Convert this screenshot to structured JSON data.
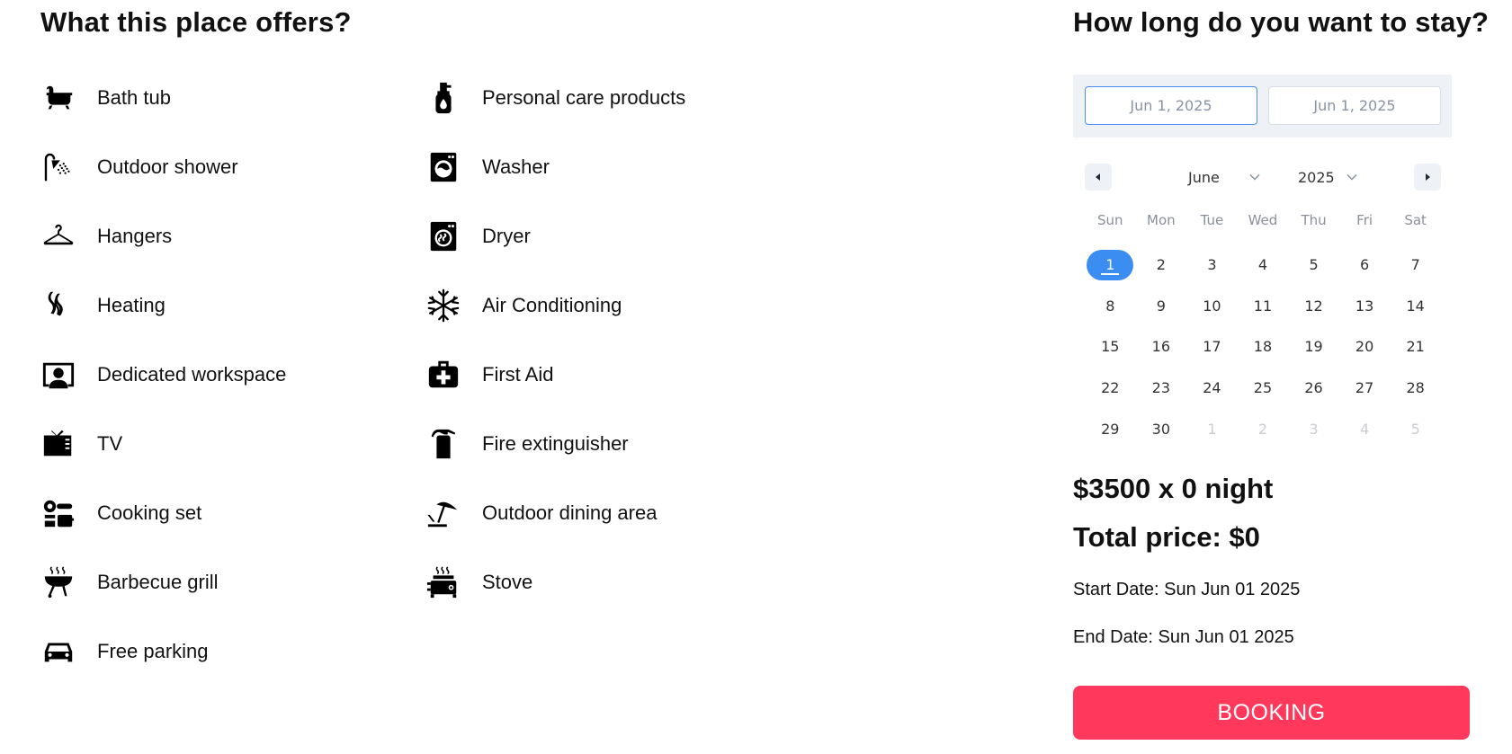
{
  "offers": {
    "title": "What this place offers?",
    "column1": [
      {
        "label": "Bath tub",
        "icon": "bathtub-icon"
      },
      {
        "label": "Outdoor shower",
        "icon": "shower-icon"
      },
      {
        "label": "Hangers",
        "icon": "hanger-icon"
      },
      {
        "label": "Heating",
        "icon": "heating-icon"
      },
      {
        "label": "Dedicated workspace",
        "icon": "workspace-icon"
      },
      {
        "label": "TV",
        "icon": "tv-icon"
      },
      {
        "label": "Cooking set",
        "icon": "cooking-set-icon"
      },
      {
        "label": "Barbecue grill",
        "icon": "barbecue-icon"
      },
      {
        "label": "Free parking",
        "icon": "car-icon"
      }
    ],
    "column2": [
      {
        "label": "Personal care products",
        "icon": "soap-bottle-icon"
      },
      {
        "label": "Washer",
        "icon": "washer-icon"
      },
      {
        "label": "Dryer",
        "icon": "dryer-icon"
      },
      {
        "label": "Air Conditioning",
        "icon": "snowflake-icon"
      },
      {
        "label": "First Aid",
        "icon": "first-aid-icon"
      },
      {
        "label": "Fire extinguisher",
        "icon": "fire-extinguisher-icon"
      },
      {
        "label": "Outdoor dining area",
        "icon": "umbrella-icon"
      },
      {
        "label": "Stove",
        "icon": "stove-icon"
      }
    ]
  },
  "stay": {
    "title": "How long do you want to stay?",
    "start_input": "Jun 1, 2025",
    "end_input": "Jun 1, 2025",
    "calendar": {
      "month": "June",
      "year": "2025",
      "weekdays": [
        "Sun",
        "Mon",
        "Tue",
        "Wed",
        "Thu",
        "Fri",
        "Sat"
      ],
      "days": [
        {
          "d": "1",
          "state": "selected"
        },
        {
          "d": "2"
        },
        {
          "d": "3"
        },
        {
          "d": "4"
        },
        {
          "d": "5"
        },
        {
          "d": "6"
        },
        {
          "d": "7"
        },
        {
          "d": "8"
        },
        {
          "d": "9"
        },
        {
          "d": "10"
        },
        {
          "d": "11"
        },
        {
          "d": "12"
        },
        {
          "d": "13"
        },
        {
          "d": "14"
        },
        {
          "d": "15"
        },
        {
          "d": "16"
        },
        {
          "d": "17"
        },
        {
          "d": "18"
        },
        {
          "d": "19"
        },
        {
          "d": "20"
        },
        {
          "d": "21"
        },
        {
          "d": "22"
        },
        {
          "d": "23"
        },
        {
          "d": "24"
        },
        {
          "d": "25"
        },
        {
          "d": "26"
        },
        {
          "d": "27"
        },
        {
          "d": "28"
        },
        {
          "d": "29"
        },
        {
          "d": "30"
        },
        {
          "d": "1",
          "state": "muted"
        },
        {
          "d": "2",
          "state": "muted"
        },
        {
          "d": "3",
          "state": "muted"
        },
        {
          "d": "4",
          "state": "muted"
        },
        {
          "d": "5",
          "state": "muted"
        }
      ]
    },
    "price_line": "$3500 x 0 night",
    "total_line": "Total price: $0",
    "start_date": "Start Date: Sun Jun 01 2025",
    "end_date": "End Date: Sun Jun 01 2025",
    "booking_label": "BOOKING",
    "colors": {
      "accent": "#3b8df1",
      "booking": "#ff385c"
    }
  }
}
